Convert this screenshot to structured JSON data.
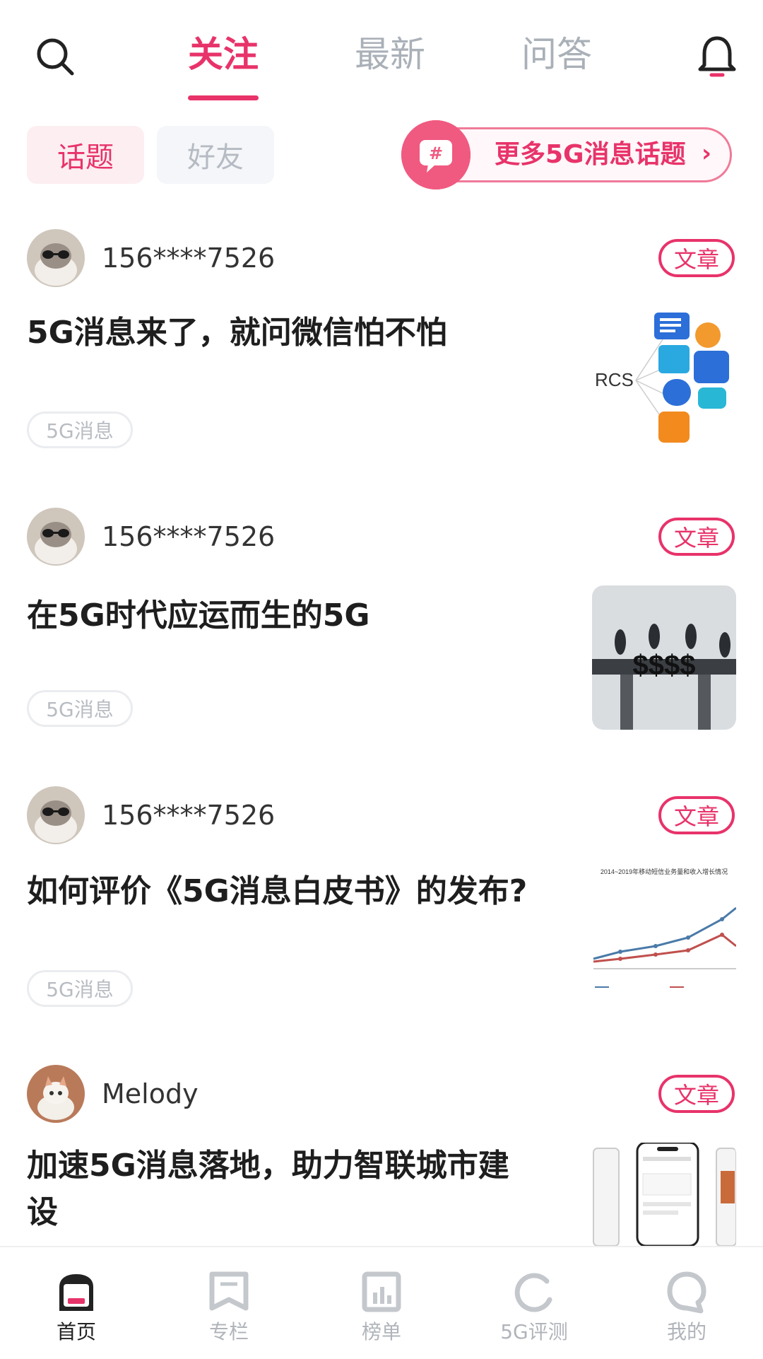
{
  "top_tabs": [
    "关注",
    "最新",
    "问答"
  ],
  "sub_tabs": [
    "话题",
    "好友"
  ],
  "topic_banner": {
    "label": "更多5G消息话题",
    "chevron": "›",
    "icon_glyph": "#"
  },
  "posts": [
    {
      "author": "156****7526",
      "badge": "文章",
      "title": "5G消息来了，就问微信怕不怕",
      "tag": "5G消息",
      "thumb_label": "RCS"
    },
    {
      "author": "156****7526",
      "badge": "文章",
      "title": "在5G时代应运而生的5G",
      "tag": "5G消息",
      "thumb_label": "$$$$"
    },
    {
      "author": "156****7526",
      "badge": "文章",
      "title": "如何评价《5G消息白皮书》的发布?",
      "tag": "5G消息",
      "thumb_label": "2014~2019年移动短信业务量和收入增长情况"
    },
    {
      "author": "Melody",
      "badge": "文章",
      "title": "加速5G消息落地，助力智联城市建设"
    }
  ],
  "bottom_nav": [
    "首页",
    "专栏",
    "榜单",
    "5G评测",
    "我的"
  ],
  "colors": {
    "accent": "#e8336a",
    "muted": "#b0b4ba"
  }
}
